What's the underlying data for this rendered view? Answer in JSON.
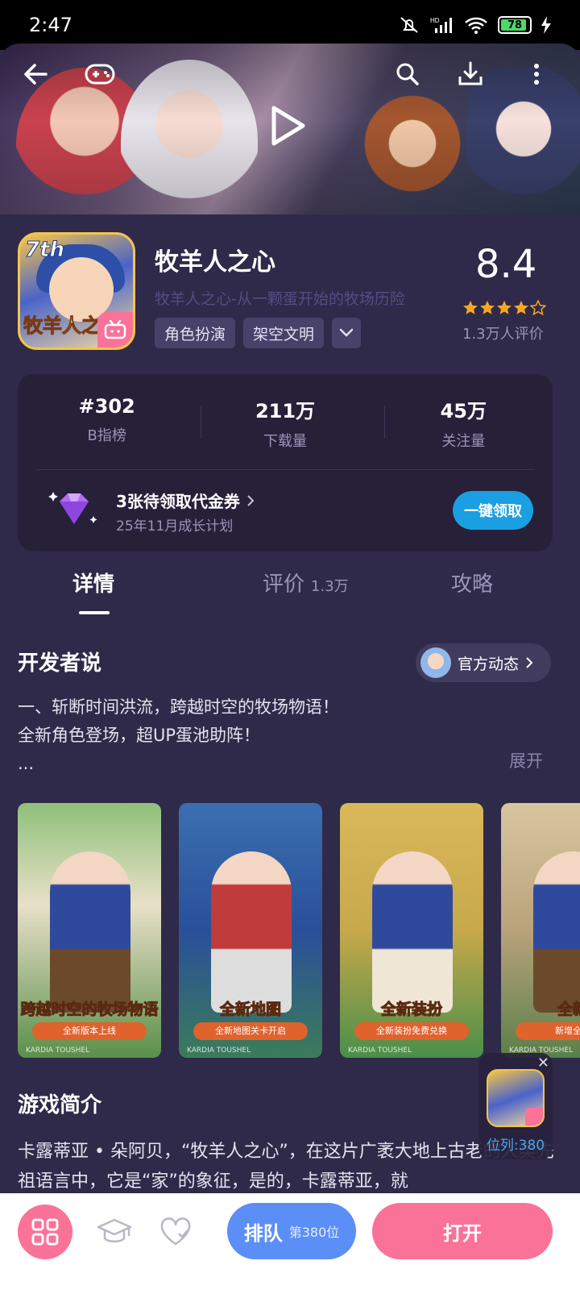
{
  "status_bar": {
    "time": "2:47",
    "battery": "78",
    "battery_level": 0.78
  },
  "app": {
    "title": "牧羊人之心",
    "subtitle": "牧羊人之心-从一颗蛋开始的牧场历险",
    "icon_badge": "7th",
    "icon_logo_text": "牧羊人之心",
    "tags": [
      "角色扮演",
      "架空文明"
    ],
    "rating": "8.4",
    "rating_stars": 4.5,
    "rating_count": "1.3万人评价"
  },
  "stats": [
    {
      "value": "#302",
      "label": "B指榜"
    },
    {
      "value": "211万",
      "label": "下载量"
    },
    {
      "value": "45万",
      "label": "关注量"
    }
  ],
  "coupon": {
    "title": "3张待领取代金券",
    "subtitle": "25年11月成长计划",
    "button": "一键领取"
  },
  "tabs": [
    {
      "label": "详情",
      "count": ""
    },
    {
      "label": "评价",
      "count": "1.3万"
    },
    {
      "label": "攻略",
      "count": ""
    }
  ],
  "developer": {
    "title": "开发者说",
    "official_button": "官方动态",
    "lines": [
      "一、斩断时间洪流，跨越时空的牧场物语！",
      "全新角色登场，超UP蛋池助阵！",
      "..."
    ],
    "expand": "展开"
  },
  "screenshots": [
    {
      "caption": "跨越时空的牧场物语",
      "pill": "全新版本上线",
      "brand": "KARDIA TOUSHEL"
    },
    {
      "caption": "全新地图",
      "pill": "全新地图关卡开启",
      "brand": "KARDIA TOUSHEL"
    },
    {
      "caption": "全新装扮",
      "pill": "全新装扮免费兑换",
      "brand": "KARDIA TOUSHEL"
    },
    {
      "caption": "全新",
      "pill": "新增全新",
      "brand": "KARDIA TOUSHEL"
    }
  ],
  "intro": {
    "title": "游戏简介",
    "text": "卡露蒂亚 • 朵阿贝，“牧羊人之心”，在这片广袤大地上古老的人类先祖语言中，它是“家”的象征，是的，卡露蒂亚，就"
  },
  "float_widget": {
    "position": "位列:380",
    "close": "✕"
  },
  "bottom_bar": {
    "queue_label": "排队",
    "queue_position": "第380位",
    "open_label": "打开"
  },
  "colors": {
    "accent_pink": "#fb7299",
    "accent_blue": "#5b8ef7",
    "claim_blue": "#1a9fe2",
    "background": "#2f2a49"
  }
}
